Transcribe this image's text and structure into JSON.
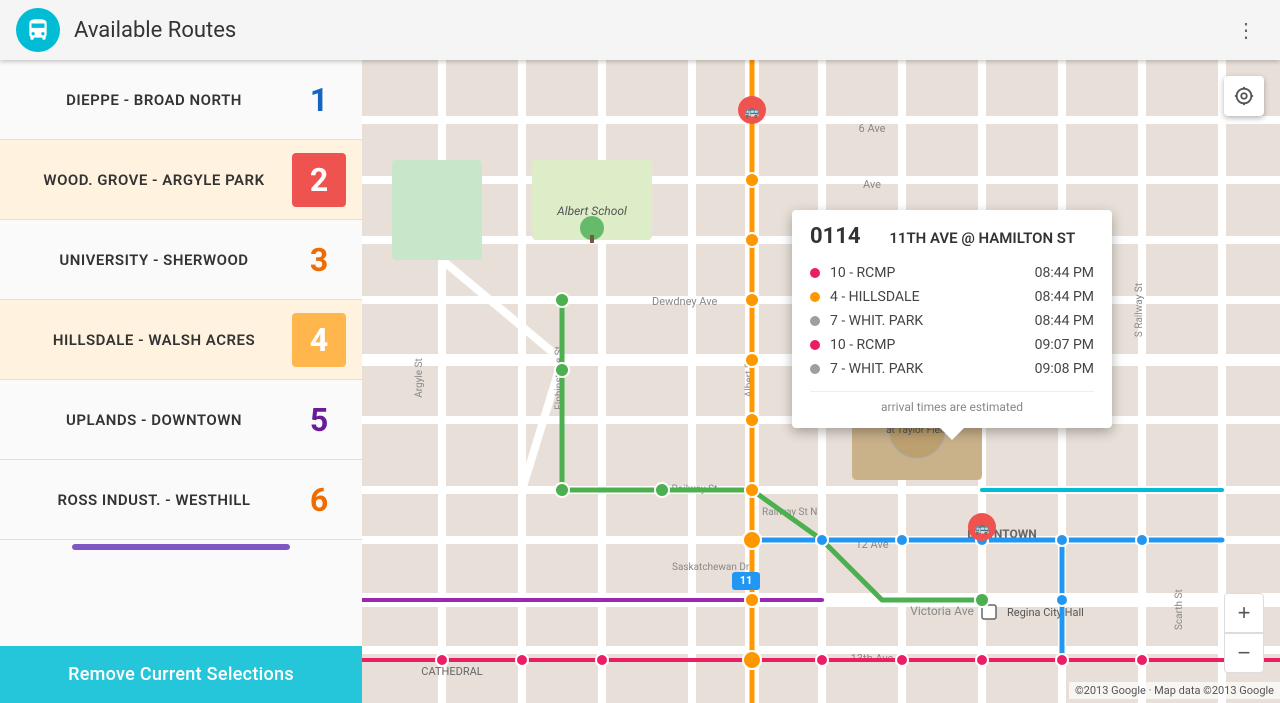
{
  "header": {
    "title": "Available Routes",
    "icon_alt": "bus-icon",
    "menu_icon": "⋮"
  },
  "routes": [
    {
      "id": "r1",
      "name": "DIEPPE - BROAD NORTH",
      "number": "1",
      "num_class": "route-num-1",
      "active": false
    },
    {
      "id": "r2",
      "name": "WOOD. GROVE - ARGYLE PARK",
      "number": "2",
      "num_class": "route-num-2",
      "active": true
    },
    {
      "id": "r3",
      "name": "UNIVERSITY - SHERWOOD",
      "number": "3",
      "num_class": "route-num-3",
      "active": false
    },
    {
      "id": "r4",
      "name": "HILLSDALE - WALSH ACRES",
      "number": "4",
      "num_class": "route-num-4",
      "active": true
    },
    {
      "id": "r5",
      "name": "UPLANDS - DOWNTOWN",
      "number": "5",
      "num_class": "route-num-5",
      "active": false
    },
    {
      "id": "r6",
      "name": "ROSS INDUST. - WESTHILL",
      "number": "6",
      "num_class": "route-num-6",
      "active": false
    }
  ],
  "popup": {
    "route_num": "0114",
    "stop_name": "11TH AVE @ HAMILTON ST",
    "arrivals": [
      {
        "dot_color": "#e91e63",
        "label": "10 - RCMP",
        "time": "08:44 PM"
      },
      {
        "dot_color": "#ff9800",
        "label": "4 - HILLSDALE",
        "time": "08:44 PM"
      },
      {
        "dot_color": "#9e9e9e",
        "label": "7 - WHIT. PARK",
        "time": "08:44 PM"
      },
      {
        "dot_color": "#e91e63",
        "label": "10 - RCMP",
        "time": "09:07 PM"
      },
      {
        "dot_color": "#9e9e9e",
        "label": "7 - WHIT. PARK",
        "time": "09:08 PM"
      }
    ],
    "footer": "arrival times are estimated"
  },
  "map_controls": {
    "locate_icon": "◎",
    "zoom_in": "+",
    "zoom_out": "−"
  },
  "remove_btn": {
    "label": "Remove Current Selections"
  },
  "attribution": "©2013 Google · Map data ©2013 Google"
}
